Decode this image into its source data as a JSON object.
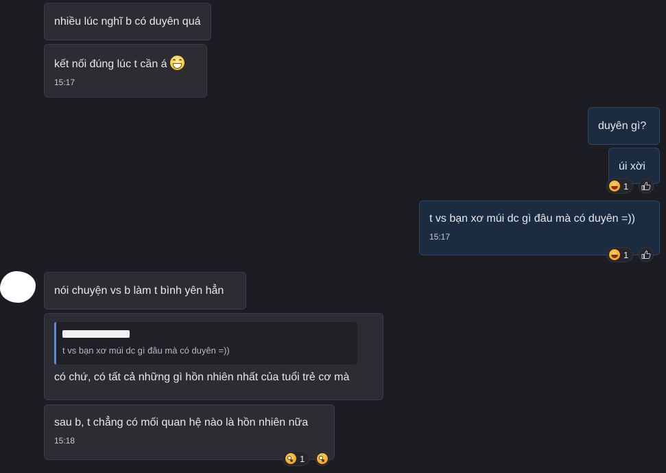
{
  "messages": [
    {
      "id": "m1",
      "text": "nhiều lúc nghĩ b có duyên quá"
    },
    {
      "id": "m2",
      "text": "kết nối đúng lúc t cần á",
      "emoji": "grinning-face-emoji",
      "time": "15:17"
    },
    {
      "id": "m3",
      "text": "duyên gì?"
    },
    {
      "id": "m4",
      "text": "úi xời",
      "reaction": {
        "emoji": "laughing-face",
        "count": "1"
      }
    },
    {
      "id": "m5",
      "text": "t vs bạn xơ múi dc gì đâu mà có duyên =))",
      "time": "15:17",
      "reaction": {
        "emoji": "laughing-face",
        "count": "1"
      }
    },
    {
      "id": "m6",
      "text": "nói chuyện vs b làm t bình yên hẳn"
    },
    {
      "id": "m7",
      "text": "có chứ, có tất cả những gì hồn nhiên nhất của tuổi trẻ cơ mà",
      "quote": {
        "text": "t vs bạn xơ múi dc gì đâu mà có duyên =))"
      }
    },
    {
      "id": "m8",
      "text": "sau b, t chẳng có mối quan hệ nào là hồn nhiên nữa",
      "time": "15:18",
      "reaction": {
        "emoji": "surprised-face",
        "count": "1"
      }
    }
  ],
  "colors": {
    "background": "#1c1d23",
    "incoming_bubble": "#2b2d33",
    "outgoing_bubble": "#1c2c40",
    "quote_bar": "#5b8bd9"
  }
}
